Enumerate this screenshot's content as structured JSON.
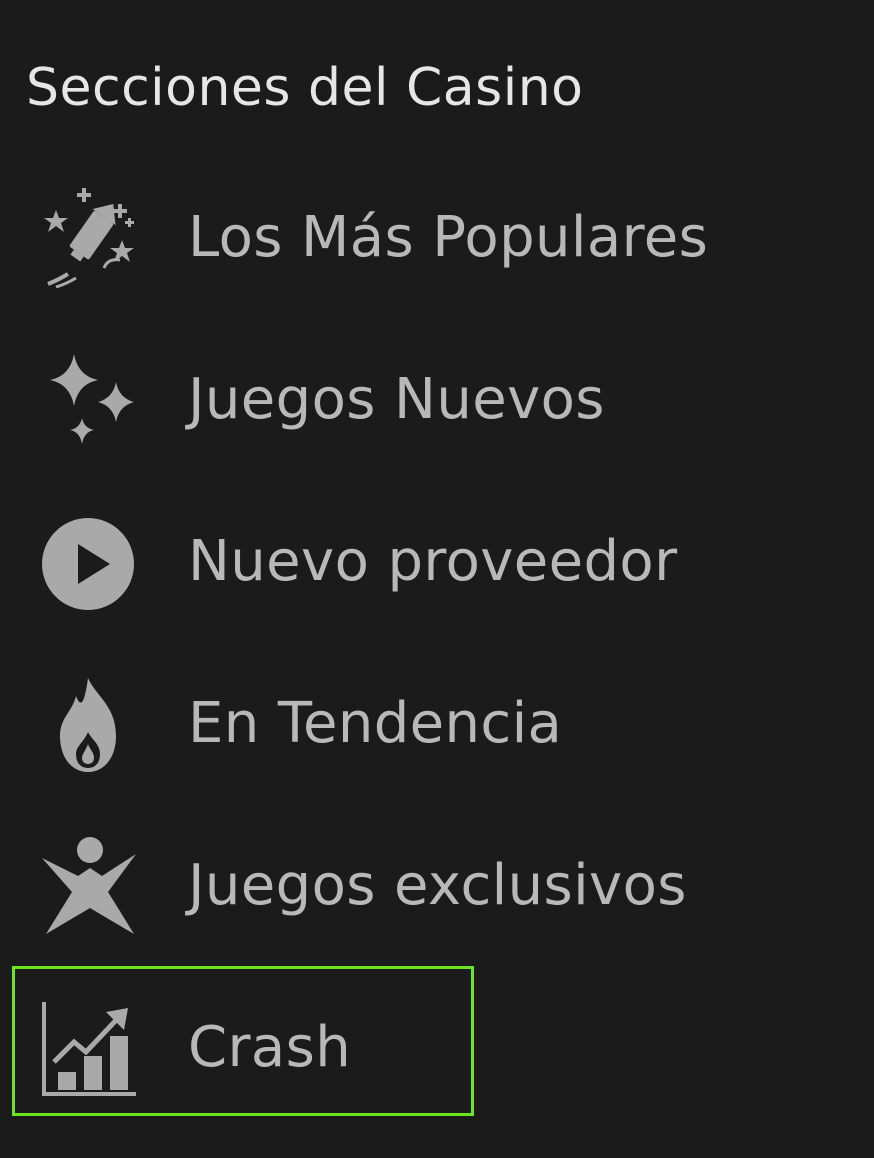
{
  "section": {
    "title": "Secciones del Casino"
  },
  "menu": {
    "items": [
      {
        "label": "Los Más Populares",
        "icon": "rocket-fireworks-icon"
      },
      {
        "label": "Juegos Nuevos",
        "icon": "sparkles-icon"
      },
      {
        "label": "Nuevo proveedor",
        "icon": "play-circle-icon"
      },
      {
        "label": "En Tendencia",
        "icon": "flame-icon"
      },
      {
        "label": "Juegos exclusivos",
        "icon": "star-person-icon"
      },
      {
        "label": "Crash",
        "icon": "chart-growth-icon",
        "selected": true
      }
    ]
  },
  "colors": {
    "background": "#1b1b1b",
    "title": "#e6e6e6",
    "label": "#b8b8b8",
    "icon": "#a9a9a9",
    "highlight": "#6ae51f"
  }
}
